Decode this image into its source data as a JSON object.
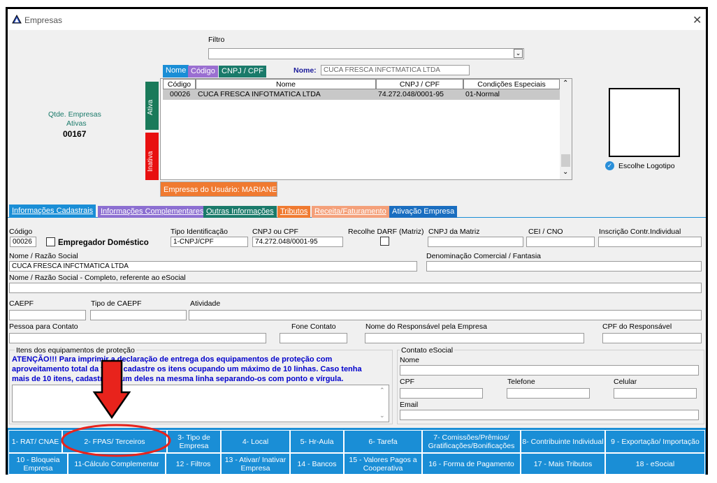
{
  "window": {
    "title": "Empresas"
  },
  "filter": {
    "label": "Filtro",
    "value": ""
  },
  "search_tabs": [
    "Nome",
    "Código",
    "CNPJ / CPF"
  ],
  "name_search": {
    "label": "Nome:",
    "value": "CUCA FRESCA INFCTMATICA LTDA"
  },
  "counter": {
    "label1": "Qtde. Empresas",
    "label2": "Ativas",
    "value": "00167"
  },
  "side_tabs": {
    "active": "Ativa",
    "inactive": "Inativa"
  },
  "grid": {
    "headers": [
      "Código",
      "Nome",
      "CNPJ / CPF",
      "Condições Especiais"
    ],
    "rows": [
      [
        "00026",
        "CUCA FRESCA INFOTMATICA LTDA",
        "74.272.048/0001-95",
        "01-Normal"
      ]
    ]
  },
  "user_companies": "Empresas do Usuário: MARIANE",
  "logo": {
    "label": "Escolhe Logotipo"
  },
  "main_tabs": [
    "Informações Cadastrais",
    "Informações Complementares",
    "Outras Informações",
    "Tributos",
    "Receita/Faturamento",
    "Ativação Empresa"
  ],
  "form": {
    "codigo_label": "Código",
    "codigo_value": "00026",
    "empregador_label": "Empregador Doméstico",
    "tipo_id_label": "Tipo Identificação",
    "tipo_id_value": "1-CNPJ/CPF",
    "cnpj_label": "CNPJ ou CPF",
    "cnpj_value": "74.272.048/0001-95",
    "darf_label": "Recolhe DARF (Matriz)",
    "cnpj_matriz_label": "CNPJ da Matriz",
    "cei_label": "CEI / CNO",
    "inscricao_label": "Inscrição Contr.Individual",
    "razao_label": "Nome / Razão Social",
    "razao_value": "CUCA FRESCA INFCTMATICA LTDA",
    "fantasia_label": "Denominação Comercial / Fantasia",
    "razao_completo_label": "Nome / Razão Social - Completo, referente ao eSocial",
    "caepf_label": "CAEPF",
    "tipo_caepf_label": "Tipo de CAEPF",
    "atividade_label": "Atividade",
    "contato_label": "Pessoa para Contato",
    "fone_label": "Fone Contato",
    "responsavel_label": "Nome do Responsável pela Empresa",
    "cpf_resp_label": "CPF do Responsável"
  },
  "equip": {
    "legend": "Itens dos equipamentos de proteção",
    "line1": "ATENÇÃO!!! Para imprimir a declaração de entrega dos equipamentos de proteção com",
    "line2": "aproveitamento total da folha, cadastre os itens ocupando um máximo de 10 linhas. Caso tenha",
    "line3": "mais de 10 itens, cadastre algum deles na mesma linha separando-os com ponto e vírgula."
  },
  "esocial_contact": {
    "legend": "Contato eSocial",
    "nome": "Nome",
    "cpf": "CPF",
    "telefone": "Telefone",
    "celular": "Celular",
    "email": "Email"
  },
  "buttons_row1": [
    "1- RAT/ CNAE",
    "2- FPAS/ Terceiros",
    "3- Tipo de Empresa",
    "4- Local",
    "5- Hr-Aula",
    "6- Tarefa",
    "7- Comissões/Prêmios/ Gratificações/Bonificações",
    "8- Contribuinte Individual",
    "9 - Exportação/ Importação"
  ],
  "buttons_row2": [
    "10 - Bloqueia Empresa",
    "11-Cálculo Complementar",
    "12 - Filtros",
    "13 - Ativar/ Inativar Empresa",
    "14 - Bancos",
    "15 - Valores Pagos a Cooperativa",
    "16 - Forma de Pagamento",
    "17 - Mais Tributos",
    "18 - eSocial"
  ],
  "colors": {
    "accent": "#1a8ed6",
    "highlight": "#e8231c",
    "active_tab": "#1a7a5a",
    "inactive_tab": "#e81010"
  }
}
